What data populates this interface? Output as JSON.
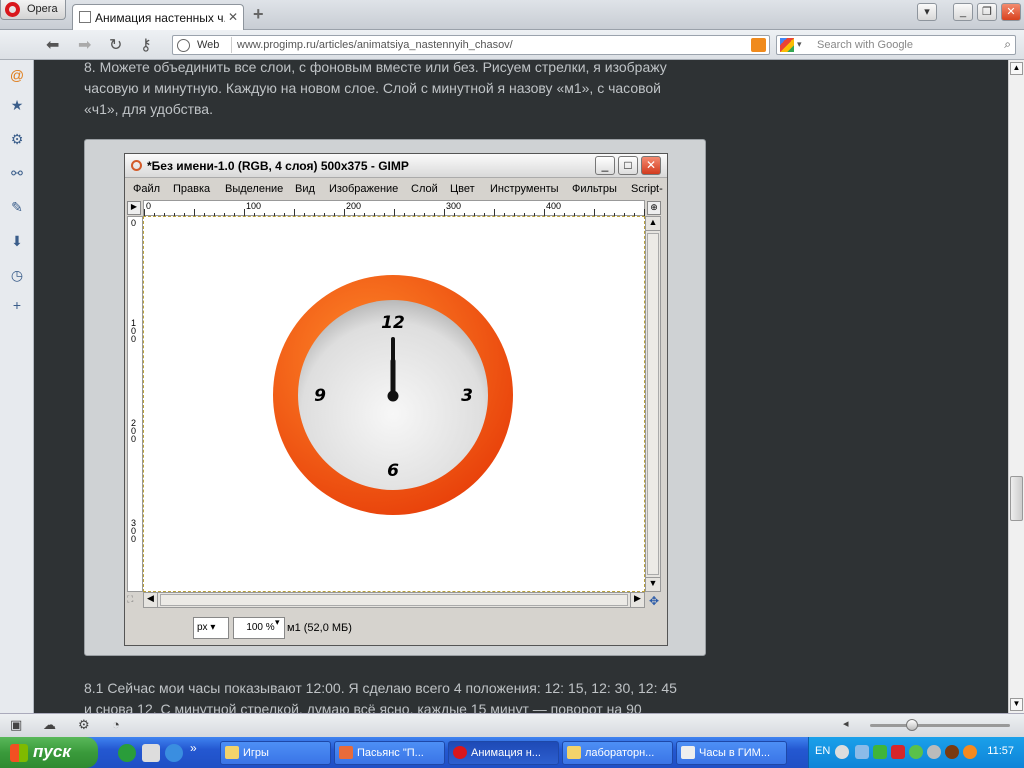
{
  "browser": {
    "menu_label": "Opera",
    "tab_title": "Анимация настенных ч...",
    "tab_close": "✕",
    "newtab": "+",
    "address_prefix": "Web",
    "url": "www.progimp.ru/articles/animatsiya_nastennyih_chasov/",
    "search_placeholder": "Search with Google"
  },
  "article": {
    "para1_line1": "8. Можете объединить все слои, с фоновым вместе или без. Рисуем стрелки, я изображу",
    "para1_line2": "часовую и минутную. Каждую на новом слое. Слой с минутной я назову «м1», с часовой",
    "para1_line3": "«ч1», для удобства.",
    "para2_line1": "8.1 Сейчас мои часы показывают 12:00. Я сделаю всего 4 положения: 12: 15, 12: 30, 12: 45",
    "para2_line2": "и снова 12. С минутной стрелкой, думаю всё ясно, каждые 15 минут — поворот на 90"
  },
  "gimp": {
    "title": "*Без имени-1.0 (RGB, 4 слоя) 500x375 - GIMP",
    "menu": [
      "Файл",
      "Правка",
      "Выделение",
      "Вид",
      "Изображение",
      "Слой",
      "Цвет",
      "Инструменты",
      "Фильтры",
      "Script-"
    ],
    "hruler": [
      "0",
      "100",
      "200",
      "300",
      "400"
    ],
    "vruler": [
      "0",
      "100",
      "200",
      "300"
    ],
    "unit": "px",
    "zoom": "100 %",
    "layer_info": "м1 (52,0 МБ)"
  },
  "clock": {
    "numbers": [
      "12",
      "3",
      "6",
      "9"
    ],
    "ring_color": "#ff5a12",
    "face_color": "#e8e8e8",
    "hour_hand_angle_deg": 0,
    "minute_hand_angle_deg": 0
  },
  "taskbar": {
    "start": "пуск",
    "buttons": [
      "Игры",
      "Пасьянс \"П...",
      "Анимация н...",
      "лабораторн...",
      "Часы в ГИМ..."
    ],
    "lang": "EN",
    "time": "11:57"
  }
}
